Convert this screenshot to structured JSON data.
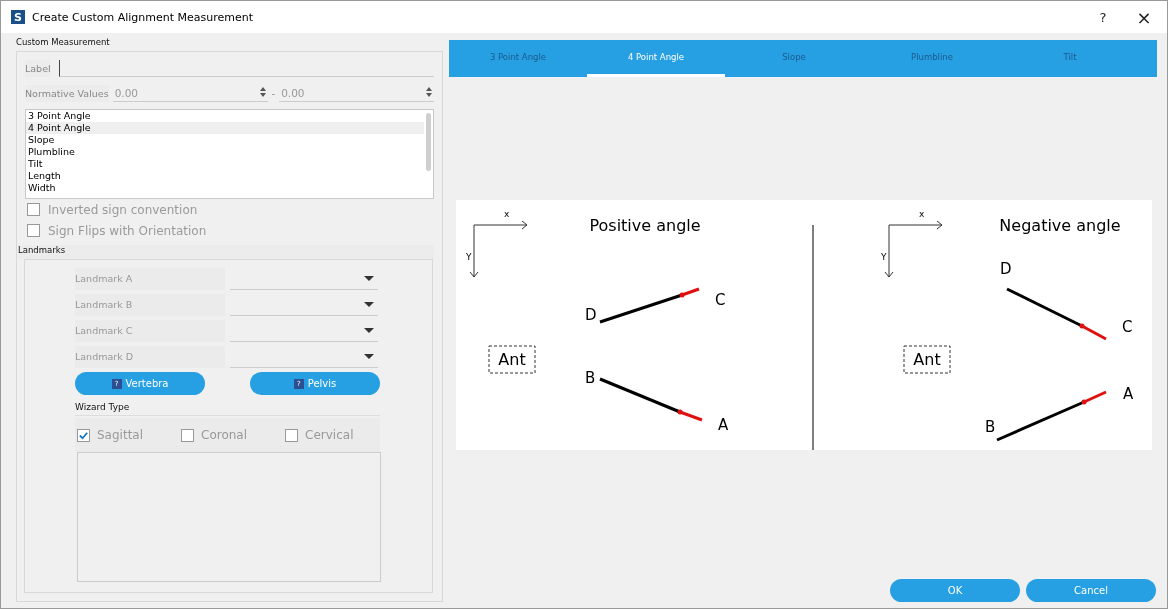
{
  "window": {
    "logo": "S",
    "title": "Create Custom Alignment Measurement",
    "help": "?",
    "close": "×"
  },
  "custom_measurement": {
    "title": "Custom Measurement",
    "label_field": {
      "label": "Label"
    },
    "normative": {
      "label": "Normative Values",
      "min": "0.00",
      "separator": "-",
      "max": "0.00"
    },
    "types": [
      {
        "label": "3 Point Angle",
        "selected": false
      },
      {
        "label": "4 Point Angle",
        "selected": true
      },
      {
        "label": "Slope",
        "selected": false
      },
      {
        "label": "Plumbline",
        "selected": false
      },
      {
        "label": "Tilt",
        "selected": false
      },
      {
        "label": "Length",
        "selected": false
      },
      {
        "label": "Width",
        "selected": false
      }
    ],
    "options": [
      {
        "label": "Inverted sign convention",
        "checked": false,
        "disabled": true
      },
      {
        "label": "Sign Flips with Orientation",
        "checked": false,
        "disabled": true
      }
    ]
  },
  "landmarks": {
    "title": "Landmarks",
    "fields": [
      {
        "label": "Landmark A"
      },
      {
        "label": "Landmark B"
      },
      {
        "label": "Landmark C"
      },
      {
        "label": "Landmark D"
      }
    ],
    "buttons": [
      {
        "label": "Vertebra",
        "icon": "?"
      },
      {
        "label": "Pelvis",
        "icon": "?"
      }
    ],
    "wizard_type": {
      "title": "Wizard Type",
      "options": [
        {
          "label": "Sagittal",
          "checked": true
        },
        {
          "label": "Coronal",
          "checked": false
        },
        {
          "label": "Cervical",
          "checked": false
        }
      ]
    }
  },
  "tabs": [
    {
      "label": "3 Point Angle",
      "selected": false
    },
    {
      "label": "4 Point Angle",
      "selected": true
    },
    {
      "label": "Slope",
      "selected": false
    },
    {
      "label": "Plumbline",
      "selected": false
    },
    {
      "label": "Tilt",
      "selected": false
    }
  ],
  "diagram": {
    "panels": [
      {
        "kind": "positive",
        "title": "Positive angle",
        "x_axis": "x",
        "y_axis": "Y",
        "side": "Ant",
        "points": [
          "A",
          "B",
          "C",
          "D"
        ]
      },
      {
        "kind": "negative",
        "title": "Negative angle",
        "x_axis": "x",
        "y_axis": "Y",
        "side": "Ant",
        "points": [
          "A",
          "B",
          "C",
          "D"
        ]
      }
    ]
  },
  "buttons": [
    {
      "label": "OK"
    },
    {
      "label": "Cancel"
    }
  ]
}
